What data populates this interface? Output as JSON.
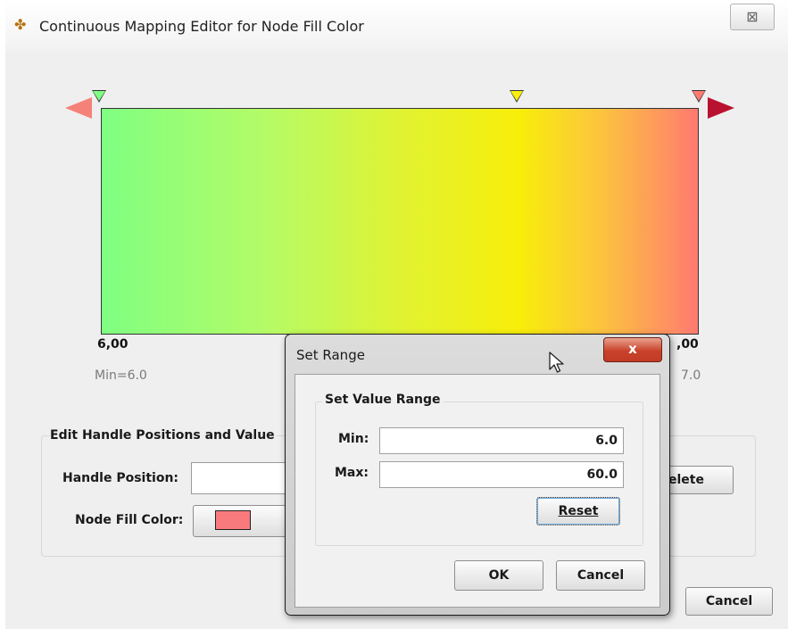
{
  "window": {
    "title": "Continuous Mapping Editor for Node Fill Color",
    "close_glyph": "⊠"
  },
  "editor": {
    "left_value": "6,00",
    "right_value": ",00",
    "min_label": "Min=6.0",
    "max_label": "7.0",
    "handle_colors": [
      "#7fff82",
      "#f8ee0a",
      "#ff7a70"
    ],
    "gradient_colors": [
      "#7fff82",
      "#f8ee0a",
      "#ff7a70"
    ]
  },
  "handle_panel": {
    "title": "Edit Handle Positions and Value",
    "position_label": "Handle Position:",
    "position_value": "",
    "color_label": "Node Fill Color:",
    "swatch_color": "#f97a7c",
    "delete_label": "elete"
  },
  "footer": {
    "cancel_label": "Cancel"
  },
  "set_range": {
    "title": "Set Range",
    "close_glyph": "x",
    "section_title": "Set Value Range",
    "min_label": "Min:",
    "min_value": "6.0",
    "max_label": "Max:",
    "max_value": "60.0",
    "reset_label": "Reset",
    "ok_label": "OK",
    "cancel_label": "Cancel"
  }
}
